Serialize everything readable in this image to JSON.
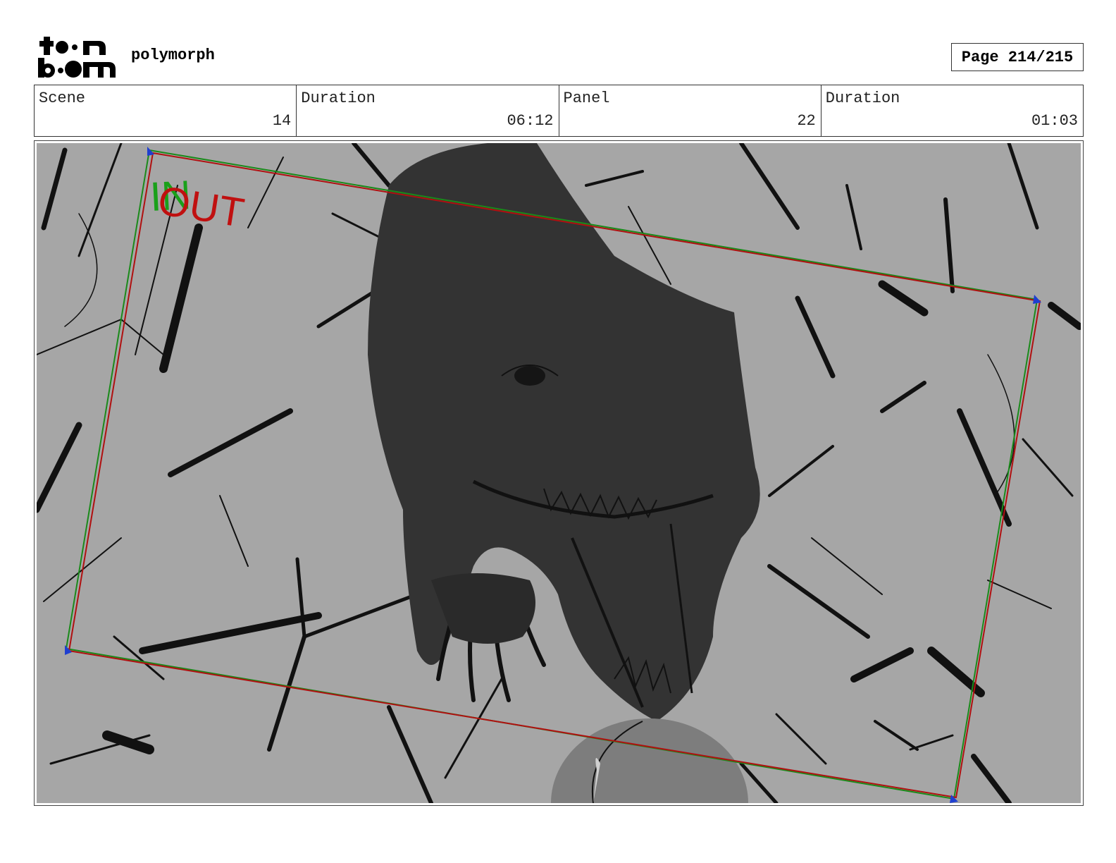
{
  "header": {
    "logo_line1": "toon",
    "logo_line2": "boom",
    "project_name": "polymorph",
    "page_label": "Page 214/215"
  },
  "info": {
    "scene_label": "Scene",
    "scene_value": "14",
    "scene_duration_label": "Duration",
    "scene_duration_value": "06:12",
    "panel_label": "Panel",
    "panel_value": "22",
    "panel_duration_label": "Duration",
    "panel_duration_value": "01:03"
  },
  "panel": {
    "camera_in_label": "IN",
    "camera_out_label": "OUT",
    "colors": {
      "background": "#a6a6a6",
      "creature": "#333333",
      "in_frame": "#1a8a1a",
      "out_frame": "#b01010",
      "keyframe_marker": "#1f3fd0"
    },
    "image_description": "Rough storyboard sketch of a dinosaur-like creature roaring from a rocky crevice toward a dome, with camera IN and OUT frame overlays"
  }
}
